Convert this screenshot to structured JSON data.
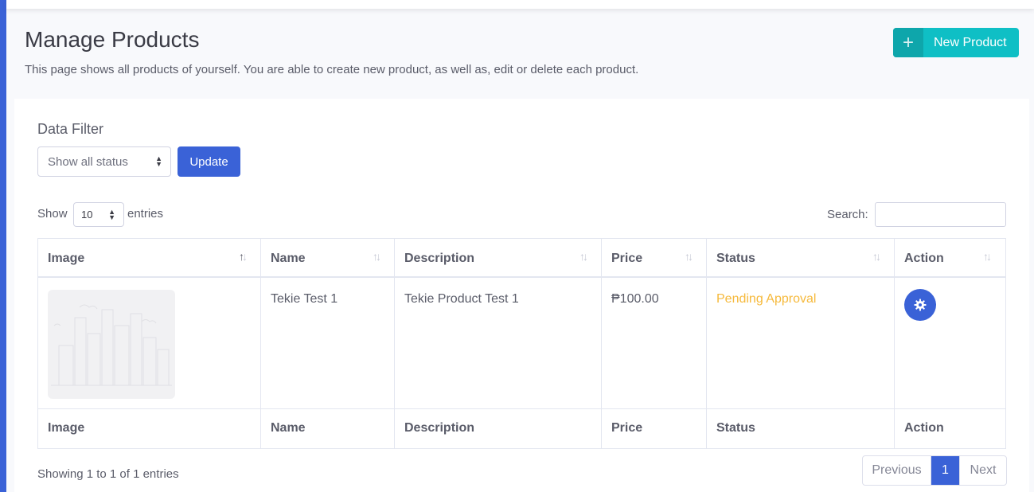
{
  "header": {
    "title": "Manage Products",
    "description": "This page shows all products of yourself. You are able to create new product, as well as, edit or delete each product.",
    "new_button_label": "New Product"
  },
  "filter": {
    "title": "Data Filter",
    "status_selected": "Show all status",
    "update_label": "Update"
  },
  "table_controls": {
    "show_label": "Show",
    "length_value": "10",
    "entries_label": "entries",
    "search_label": "Search:",
    "search_value": ""
  },
  "table": {
    "columns": [
      "Image",
      "Name",
      "Description",
      "Price",
      "Status",
      "Action"
    ],
    "rows": [
      {
        "name": "Tekie Test 1",
        "description": "Tekie Product Test 1",
        "price": "₱100.00",
        "status": "Pending Approval"
      }
    ]
  },
  "footer": {
    "info": "Showing 1 to 1 of 1 entries",
    "previous_label": "Previous",
    "current_page": "1",
    "next_label": "Next"
  },
  "colors": {
    "primary": "#3a62d7",
    "teal": "#0fbfc5",
    "warning": "#f6b93b"
  },
  "icons": [
    "plus-icon",
    "sort-icon",
    "gear-icon",
    "select-caret-icon"
  ]
}
